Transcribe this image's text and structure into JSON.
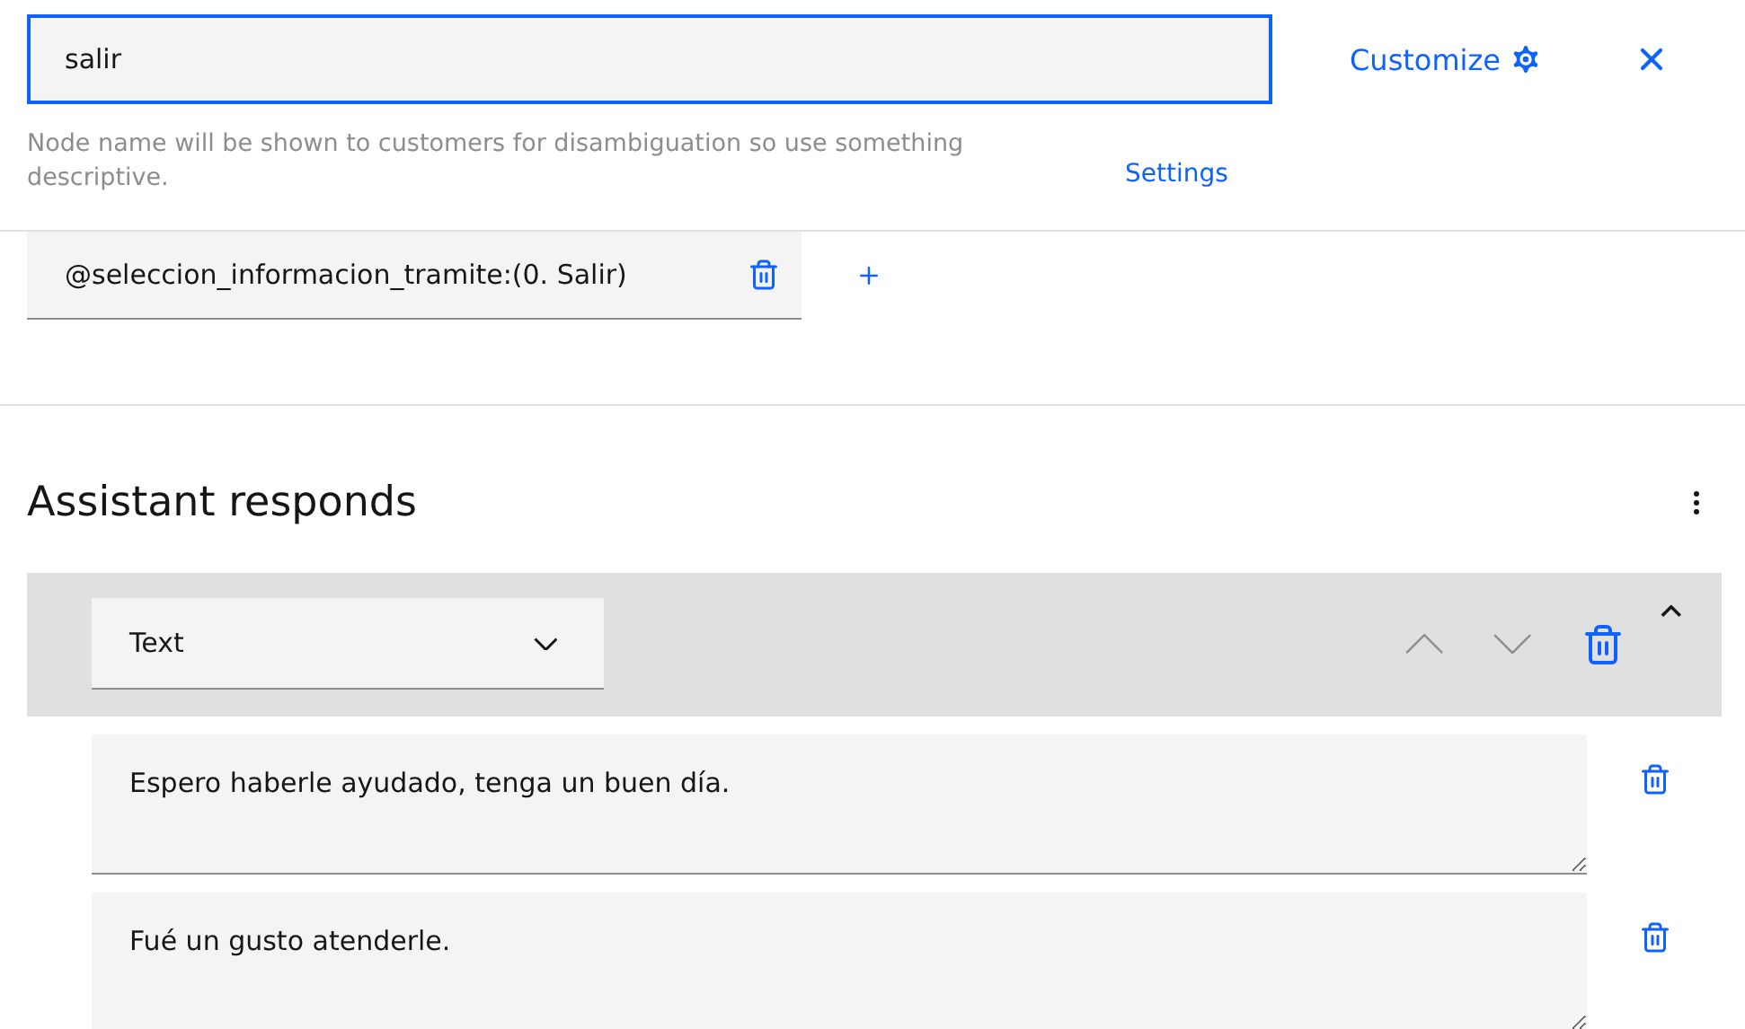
{
  "node_name": {
    "value": "salir",
    "helper": "Node name will be shown to customers for disambiguation so use something descriptive."
  },
  "header_actions": {
    "customize": "Customize",
    "settings": "Settings"
  },
  "conditions": [
    {
      "text": "@seleccion_informacion_tramite:(0. Salir)"
    }
  ],
  "assistant_responds": {
    "title": "Assistant responds",
    "response_type": "Text",
    "expanded": true,
    "variations": [
      {
        "text": "Espero haberle ayudado, tenga un buen día."
      },
      {
        "text": "Fué un gusto atenderle."
      }
    ]
  }
}
